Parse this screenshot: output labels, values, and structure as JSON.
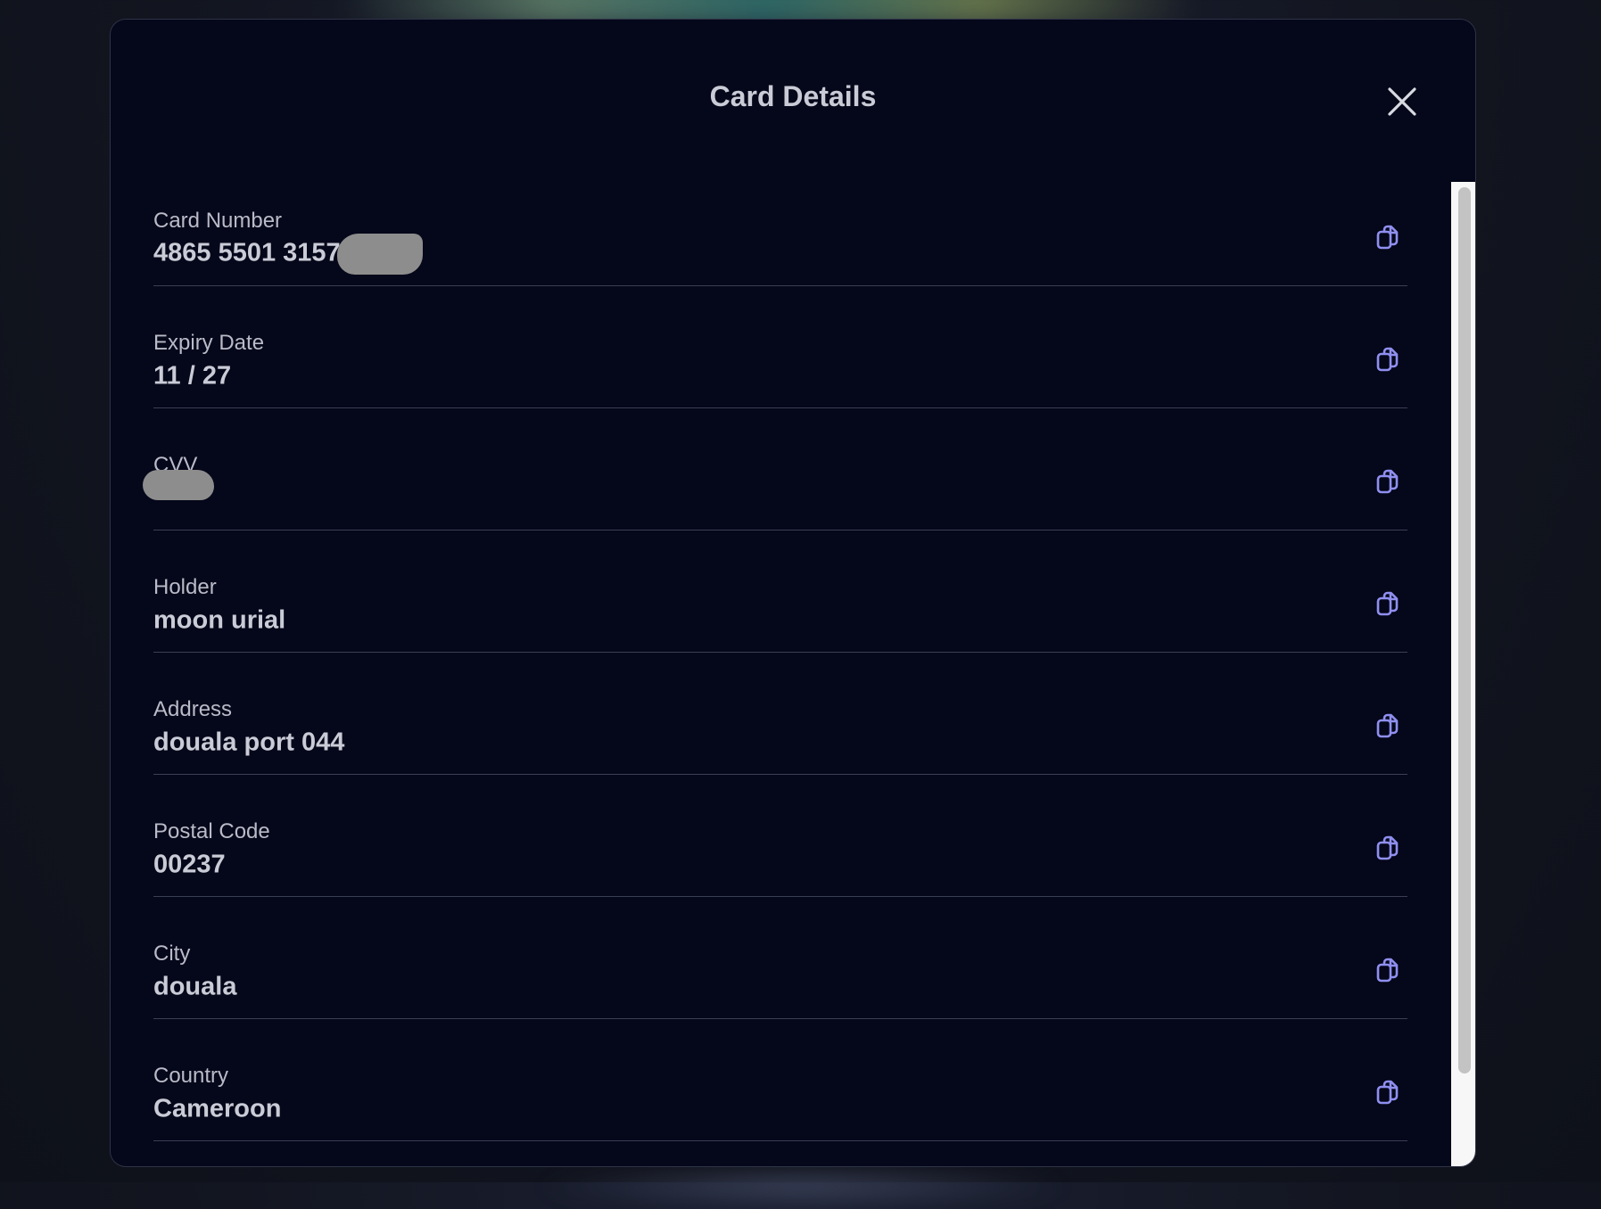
{
  "modal": {
    "title": "Card Details"
  },
  "fields": [
    {
      "label": "Card Number",
      "value": "4865 5501 3157",
      "redacted_suffix": true
    },
    {
      "label": "Expiry Date",
      "value": "11 / 27"
    },
    {
      "label": "CVV",
      "value": "",
      "redacted": true
    },
    {
      "label": "Holder",
      "value": "moon urial"
    },
    {
      "label": "Address",
      "value": "douala port 044"
    },
    {
      "label": "Postal Code",
      "value": "00237"
    },
    {
      "label": "City",
      "value": "douala"
    },
    {
      "label": "Country",
      "value": "Cameroon"
    }
  ],
  "icons": {
    "close": "close-icon",
    "copy": "copy-icon"
  },
  "colors": {
    "modal_background": "#05071a",
    "copy_icon": "#8f8ff0",
    "text": "#c9cbd6",
    "divider": "#3b3f55"
  }
}
